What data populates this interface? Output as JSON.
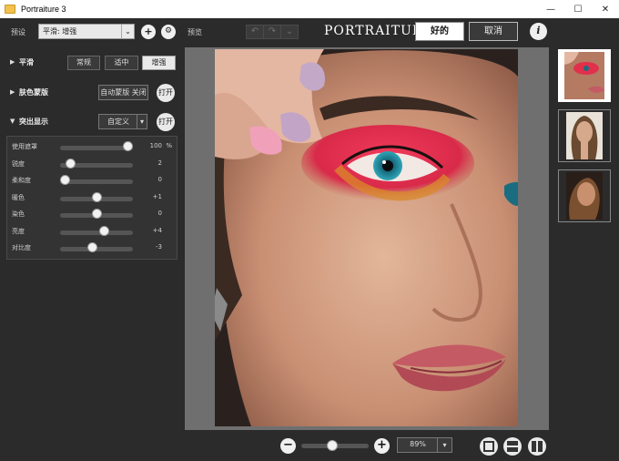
{
  "window": {
    "title": "Portraiture 3",
    "controls": {
      "minimize": "—",
      "maximize": "☐",
      "close": "✕"
    }
  },
  "toolbar": {
    "preset_label": "预设",
    "preset_value": "平滑: 增强",
    "add_label": "+",
    "settings_label": "⚙",
    "preview_label": "预览",
    "undo_label": "↶",
    "redo_label": "↷",
    "history_label": "⌄",
    "brand": "PORTRAITURI",
    "ok_label": "好的",
    "cancel_label": "取消",
    "info_label": "i"
  },
  "sections": {
    "smoothing": {
      "title": "平滑",
      "options": [
        {
          "label": "常规",
          "active": false
        },
        {
          "label": "适中",
          "active": false
        },
        {
          "label": "增强",
          "active": true
        }
      ]
    },
    "skin_mask": {
      "title": "肤色蒙版",
      "auto_mask_label": "自动蒙版 关闭",
      "open_label": "打开"
    },
    "enhancements": {
      "title": "突出显示",
      "preset_label": "自定义",
      "open_label": "打开",
      "sliders": [
        {
          "label": "使用遮罩",
          "value": "100",
          "unit": "%",
          "fraction": 1.0
        },
        {
          "label": "锐度",
          "value": "2",
          "unit": "",
          "fraction": 0.08
        },
        {
          "label": "柔和度",
          "value": "0",
          "unit": "",
          "fraction": 0.0
        },
        {
          "label": "暖色",
          "value": "+1",
          "unit": "",
          "fraction": 0.51
        },
        {
          "label": "染色",
          "value": "0",
          "unit": "",
          "fraction": 0.5
        },
        {
          "label": "亮度",
          "value": "+4",
          "unit": "",
          "fraction": 0.62
        },
        {
          "label": "对比度",
          "value": "-3",
          "unit": "",
          "fraction": 0.44
        }
      ]
    }
  },
  "bottom": {
    "zoom_out_label": "−",
    "zoom_in_label": "+",
    "zoom_value": "89%",
    "zoom_level": 0.45
  },
  "colors": {
    "background": "#2b2b2b",
    "preview_bg": "#6f6f6f",
    "button_light": "#e9e9e9",
    "eyeshadow": "#e0304c"
  }
}
